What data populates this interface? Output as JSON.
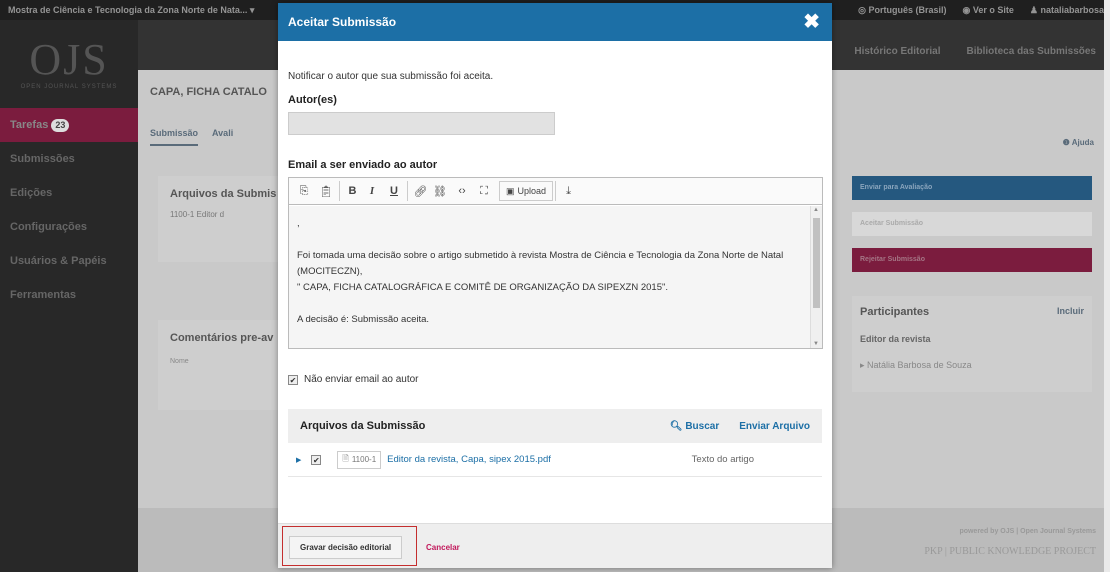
{
  "topbar": {
    "site_name": "Mostra de Ciência e Tecnologia da Zona Norte de Nata...",
    "language": "Português (Brasil)",
    "view_site": "Ver o Site",
    "user": "nataliabarbosa"
  },
  "sidebar": {
    "logo": "OJS",
    "logo_sub": "OPEN JOURNAL SYSTEMS",
    "items": [
      {
        "label": "Tarefas",
        "badge": "23"
      },
      {
        "label": "Submissões"
      },
      {
        "label": "Edições"
      },
      {
        "label": "Configurações"
      },
      {
        "label": "Usuários & Papéis"
      },
      {
        "label": "Ferramentas"
      }
    ]
  },
  "navbar": {
    "links": [
      "Histórico Editorial",
      "Biblioteca das Submissões"
    ]
  },
  "content": {
    "title": "CAPA, FICHA CATALO",
    "tabs": [
      "Submissão",
      "Avali"
    ],
    "help": "Ajuda",
    "panel1_title": "Arquivos da Submis",
    "panel1_row": "1100-1  Editor d",
    "panel2_title": "Comentários pre-av",
    "panel2_row": "Nome"
  },
  "right": {
    "send_review": "Enviar para Avaliação",
    "accept_sub": "Aceitar Submissão",
    "reject_sub": "Rejeitar Submissão",
    "participants": "Participantes",
    "include": "Incluir",
    "role": "Editor da revista",
    "person": "Natália Barbosa de Souza"
  },
  "footer": {
    "powered": "powered by OJS | Open Journal Systems",
    "pkp": "PKP | PUBLIC KNOWLEDGE PROJECT"
  },
  "modal": {
    "title": "Aceitar Submissão",
    "notify_text": "Notificar o autor que sua submissão foi aceita.",
    "authors_label": "Autor(es)",
    "authors_value": "",
    "email_label": "Email a ser enviado ao autor",
    "upload_label": "Upload",
    "email_body": {
      "line1": ",",
      "line2": "Foi tomada uma decisão sobre o artigo submetido à revista Mostra de Ciência e Tecnologia da Zona Norte de Natal (MOCITECZN),",
      "line3": "\" CAPA, FICHA CATALOGRÁFICA E COMITÊ DE ORGANIZAÇÃO DA SIPEXZN 2015\".",
      "line4": "A decisão é: Submissão aceita."
    },
    "skip_email_label": "Não enviar email ao autor",
    "skip_email_checked": true,
    "files": {
      "title": "Arquivos da Submissão",
      "search": "Buscar",
      "upload": "Enviar Arquivo",
      "rows": [
        {
          "id": "1100-1",
          "name": "Editor da revista, Capa, sipex 2015.pdf",
          "type": "Texto do artigo",
          "checked": true
        }
      ]
    },
    "save_button": "Gravar decisão editorial",
    "cancel": "Cancelar"
  },
  "colors": {
    "modal_header": "#1c6fa6",
    "link": "#1c6fa6",
    "cancel": "#c2185b",
    "highlight": "#c42e2e"
  }
}
